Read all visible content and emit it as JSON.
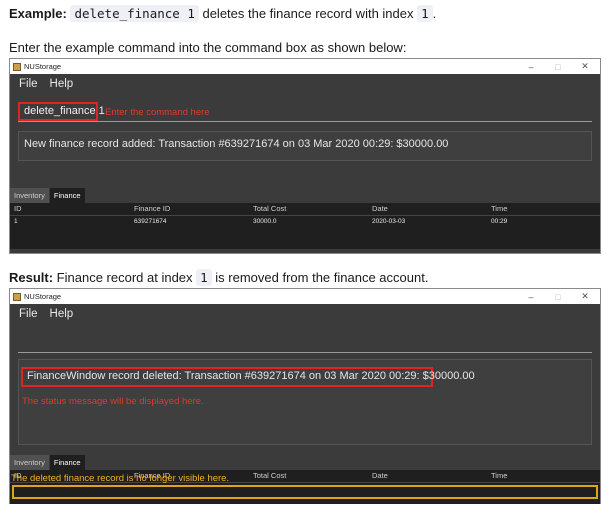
{
  "example": {
    "label": "Example:",
    "command": "delete_finance 1",
    "text_mid": " deletes the finance record with index ",
    "index": "1",
    "text_end": "."
  },
  "instruction": "Enter the example command into the command box as shown below:",
  "window1": {
    "title": "NUStorage",
    "controls": {
      "minimize": "–",
      "maximize": "□",
      "close": "✕"
    },
    "menu": {
      "file": "File",
      "help": "Help"
    },
    "command_value": "delete_finance 1",
    "command_note": "Enter the command here",
    "result_text": "New finance record added: Transaction #639271674 on 03 Mar 2020 00:29: $30000.00",
    "tabs": [
      "Inventory",
      "Finance"
    ],
    "columns": [
      "ID",
      "Finance ID",
      "Total Cost",
      "Date",
      "Time"
    ],
    "rows": [
      [
        "1",
        "639271674",
        "30000.0",
        "2020-03-03",
        "00:29"
      ]
    ]
  },
  "result": {
    "label": "Result:",
    "text_start": " Finance record at index ",
    "index": "1",
    "text_end": " is removed from the finance account."
  },
  "window2": {
    "title": "NUStorage",
    "controls": {
      "minimize": "–",
      "maximize": "□",
      "close": "✕"
    },
    "menu": {
      "file": "File",
      "help": "Help"
    },
    "result_text": "FinanceWindow record deleted: Transaction #639271674 on 03 Mar 2020 00:29: $30000.00",
    "status_note": "The status message will be displayed here.",
    "tabs": [
      "Inventory",
      "Finance"
    ],
    "columns": [
      "ID",
      "Finance ID",
      "Total Cost",
      "Date",
      "Time"
    ],
    "deleted_note": "The deleted finance record is no longer visible here."
  },
  "colors": {
    "window_bg": "#3b3b3b",
    "table_bg": "#1f1f1f",
    "highlight_red": "#e02424",
    "highlight_yellow": "#e0a516"
  }
}
